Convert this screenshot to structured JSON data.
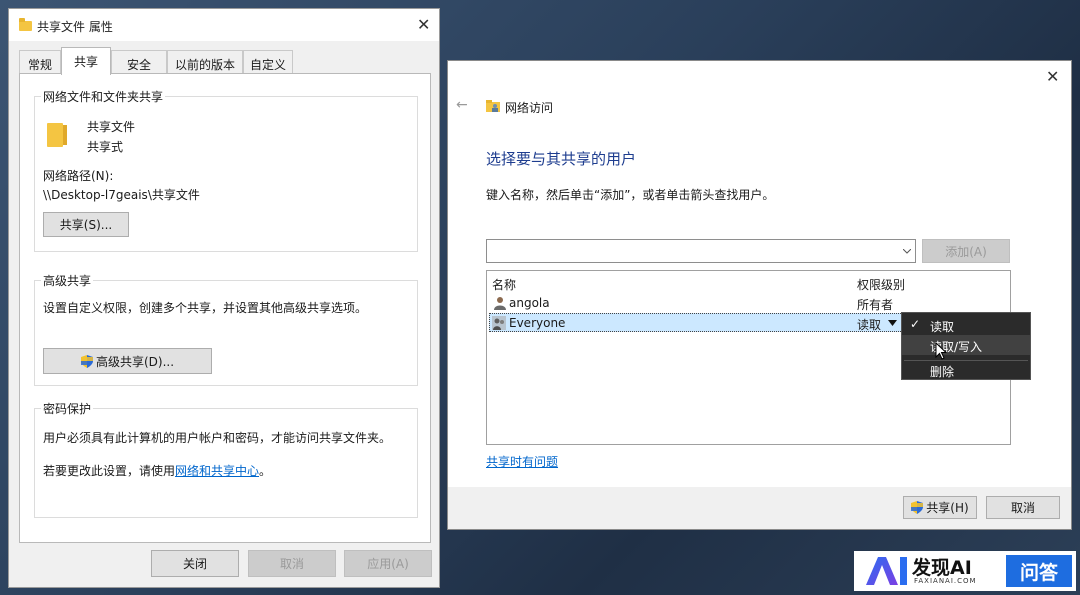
{
  "props": {
    "title": "共享文件 属性",
    "tabs": [
      "常规",
      "共享",
      "安全",
      "以前的版本",
      "自定义"
    ],
    "network_group": {
      "title": "网络文件和文件夹共享",
      "folder_name": "共享文件",
      "folder_state": "共享式",
      "path_label": "网络路径(N):",
      "path_value": "\\\\Desktop-l7geais\\共享文件",
      "share_button": "共享(S)..."
    },
    "advanced_group": {
      "title": "高级共享",
      "description": "设置自定义权限，创建多个共享，并设置其他高级共享选项。",
      "button": "高级共享(D)..."
    },
    "password_group": {
      "title": "密码保护",
      "description": "用户必须具有此计算机的用户帐户和密码，才能访问共享文件夹。",
      "change_prefix": "若要更改此设置，请使用",
      "change_link": "网络和共享中心",
      "change_suffix": "。"
    },
    "footer": {
      "close": "关闭",
      "cancel": "取消",
      "apply": "应用(A)"
    }
  },
  "network_access": {
    "breadcrumb": "网络访问",
    "heading": "选择要与其共享的用户",
    "instruction": "键入名称，然后单击“添加”，或者单击箭头查找用户。",
    "input_value": "",
    "add_button": "添加(A)",
    "columns": {
      "name": "名称",
      "permission": "权限级别"
    },
    "users": [
      {
        "name": "angola",
        "permission": "所有者"
      },
      {
        "name": "Everyone",
        "permission": "读取"
      }
    ],
    "help_link": "共享时有问题",
    "share_button": "共享(H)",
    "cancel_button": "取消"
  },
  "permission_menu": {
    "items": [
      "读取",
      "读取/写入",
      "删除"
    ],
    "checked_index": 0,
    "hover_index": 1
  },
  "watermark": {
    "logo_text": "AI",
    "brand": "发现AI",
    "brand_sub": "FAXIANAI.COM",
    "tag": "问答"
  }
}
